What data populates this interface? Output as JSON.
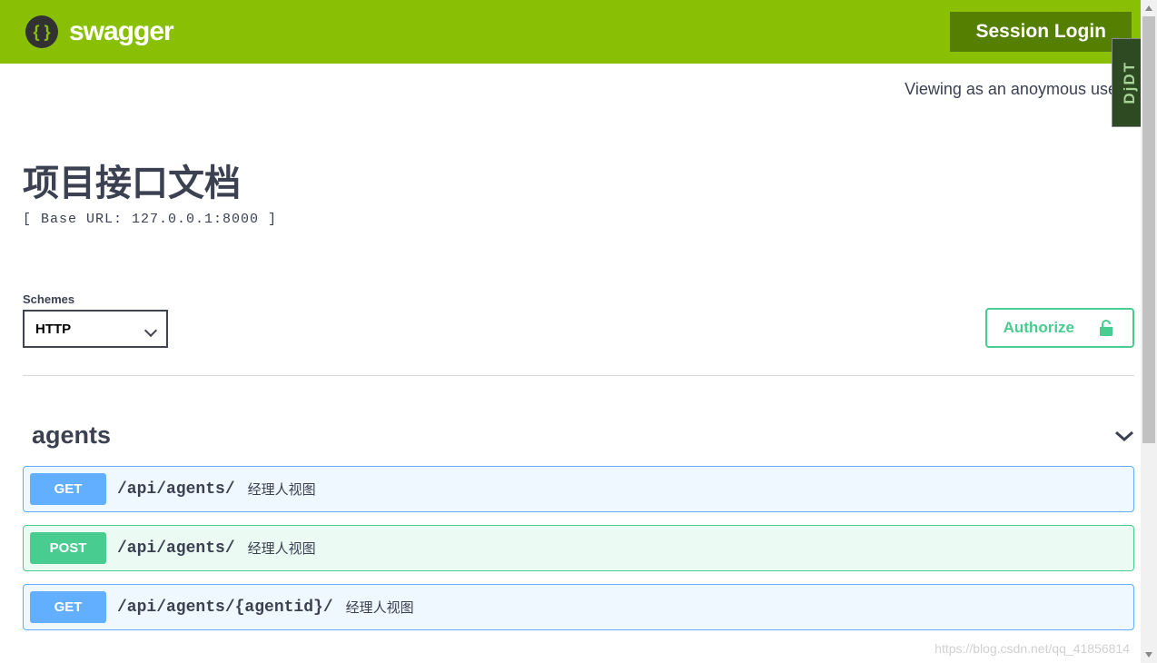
{
  "topbar": {
    "logo_text": "swagger",
    "session_login": "Session Login"
  },
  "user_banner": "Viewing as an anoymous user.",
  "djdt_label": "DjDT",
  "info": {
    "title": "项目接口文档",
    "base_url_line": "[ Base URL: 127.0.0.1:8000 ]"
  },
  "schemes": {
    "label": "Schemes",
    "selected": "HTTP"
  },
  "authorize_label": "Authorize",
  "tag": {
    "name": "agents"
  },
  "operations": [
    {
      "method": "GET",
      "method_class": "get",
      "path": "/api/agents/",
      "description": "经理人视图"
    },
    {
      "method": "POST",
      "method_class": "post",
      "path": "/api/agents/",
      "description": "经理人视图"
    },
    {
      "method": "GET",
      "method_class": "get",
      "path": "/api/agents/{agentid}/",
      "description": "经理人视图"
    }
  ],
  "watermark": "https://blog.csdn.net/qq_41856814"
}
